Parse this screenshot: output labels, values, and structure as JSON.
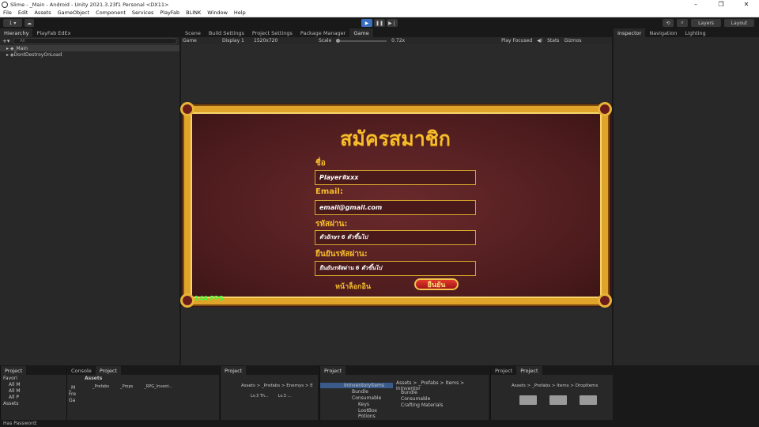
{
  "window": {
    "title": "Slime - _Main - Android - Unity 2021.3.23f1 Personal <DX11>",
    "min": "–",
    "max": "❐",
    "close": "✕"
  },
  "menu": [
    "File",
    "Edit",
    "Assets",
    "GameObject",
    "Component",
    "Services",
    "PlayFab",
    "BLINK",
    "Window",
    "Help"
  ],
  "toolbar": {
    "account": "1 ▾",
    "cloud": "☁",
    "layers": "Layers",
    "layout": "Layout"
  },
  "hierarchy": {
    "tabs": [
      "Hierarchy",
      "PlayFab EdEx"
    ],
    "search_placeholder": "All",
    "items": [
      "_Main",
      "DontDestroyOnLoad"
    ]
  },
  "center_tabs": [
    "Scene",
    "Build Settings",
    "Project Settings",
    "Package Manager",
    "Game"
  ],
  "game_toolbar": {
    "mode": "Game",
    "display": "Display 1",
    "resolution": "1520x720",
    "scale_label": "Scale",
    "scale_value": "0.72x",
    "play_focused": "Play Focused",
    "stats": "Stats",
    "gizmos": "Gizmos"
  },
  "right_tabs": [
    "Inspector",
    "Navigation",
    "Lighting"
  ],
  "form": {
    "title": "สมัครสมาชิก",
    "name_label": "ชื่อ",
    "name_value": "Player#xxx",
    "email_label": "Email:",
    "email_value": "email@gmail.com",
    "password_label": "รหัสผ่าน:",
    "password_value": "ตัวอักษร 6 ตัวขึ้นไป",
    "confirm_label": "ยืนยันรหัสผ่าน:",
    "confirm_value": "ยืนยันรหัสผ่าน 6 ตัวขึ้นไป",
    "login_link": "หน้าล็อกอิน",
    "confirm_button": "ยืนยัน",
    "fps": "144 FPS"
  },
  "bottom": {
    "p1_tabs": [
      "Project"
    ],
    "p1_favorites": "Favori",
    "p1_fav_items": [
      "All M",
      "All M",
      "All P"
    ],
    "p1_assets_root": "Assets",
    "p2_tabs": [
      "Console",
      "Project"
    ],
    "p2_left": [
      "_M",
      "Fre",
      "Ga"
    ],
    "p2_breadcrumb": "Assets",
    "p2_items": [
      "_Prefabs",
      "_Props",
      "_RPG_Invent..."
    ],
    "p3_tabs": [
      "Project"
    ],
    "p3_breadcrumb": "Assets > _Prefabs > Enemys > E",
    "p3_items": [
      "Lv.3 Th...",
      "Lv.3 ..."
    ],
    "p4_tabs": [
      "Project"
    ],
    "p4_tree": [
      "InInventoryItems",
      "Bundle",
      "Consumable",
      "Keys",
      "LootBox",
      "Potions"
    ],
    "p4_breadcrumb": "Assets > _Prefabs > Items > InInventor",
    "p4_items": [
      "Bundle",
      "Consumable",
      "Crafting Materials"
    ],
    "p5_tabs": [
      "Project",
      "Project"
    ],
    "p5_breadcrumb": "Assets > _Prefabs > Items > DropItems",
    "count_label": "5"
  },
  "status": "Has Password:"
}
